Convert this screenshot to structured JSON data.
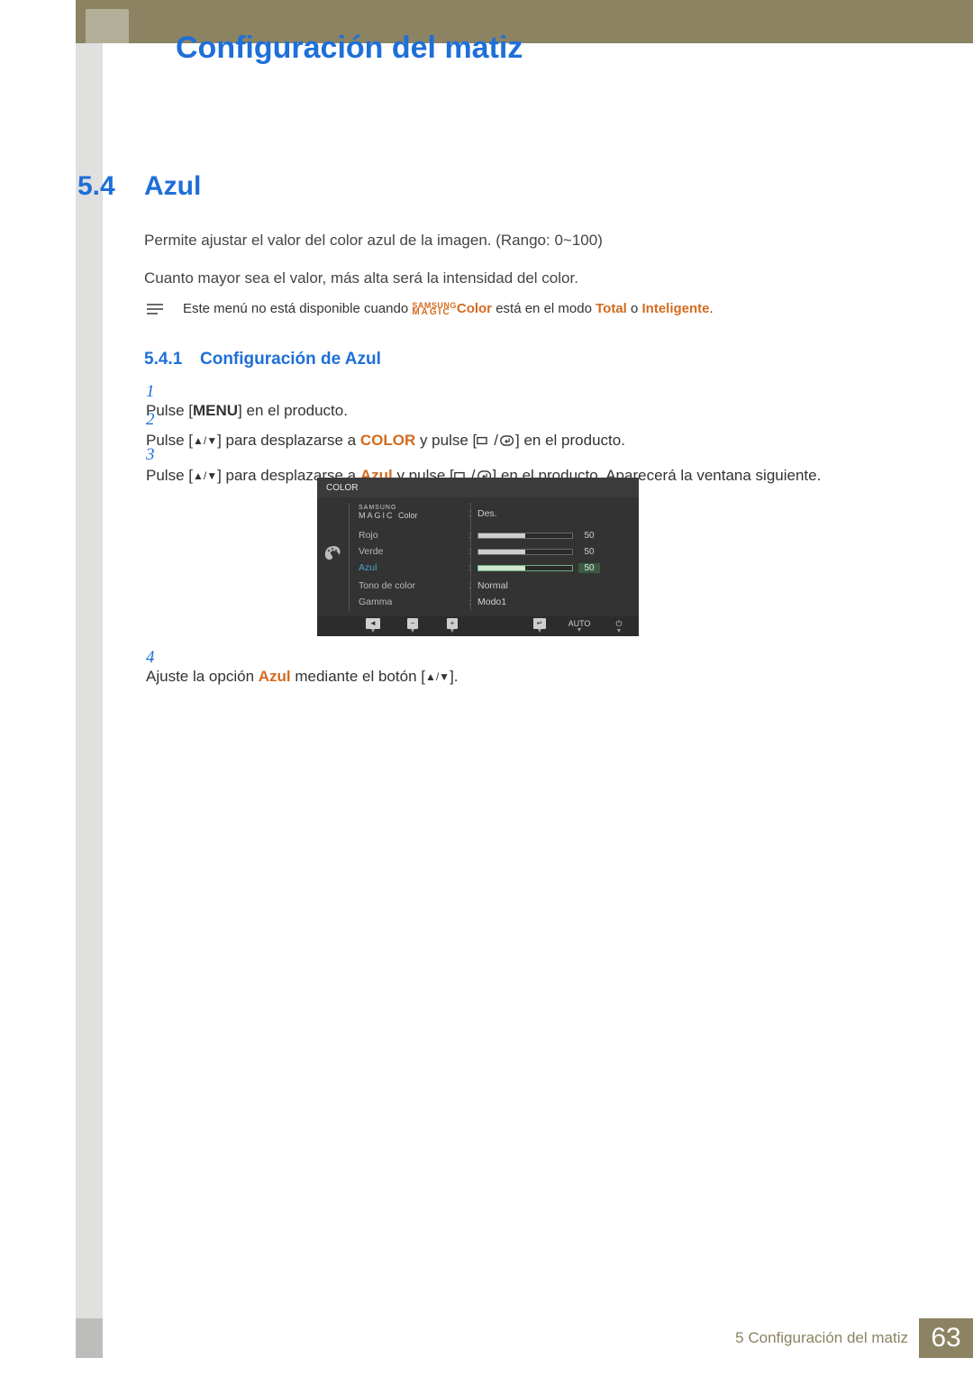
{
  "chapter_title": "Configuración del matiz",
  "section": {
    "num": "5.4",
    "title": "Azul"
  },
  "para1": "Permite ajustar el valor del color azul de la imagen. (Rango: 0~100)",
  "para2": "Cuanto mayor sea el valor, más alta será la intensidad del color.",
  "note": {
    "pre": "Este menú no está disponible cuando ",
    "magic_top": "SAMSUNG",
    "magic_bottom": "MAGIC",
    "magic_suffix": "Color",
    "mid": " está en el modo ",
    "opt1": "Total",
    "or": " o ",
    "opt2": "Inteligente",
    "end": "."
  },
  "subsection": {
    "num": "5.4.1",
    "title": "Configuración de Azul"
  },
  "steps": {
    "s1": {
      "n": "1",
      "pre": "Pulse [",
      "menu": "MENU",
      "post": "] en el producto."
    },
    "s2": {
      "n": "2",
      "pre": "Pulse [",
      "mid1": "] para desplazarse a ",
      "color": "COLOR",
      "mid2": " y pulse [",
      "post": "] en el producto."
    },
    "s3": {
      "n": "3",
      "pre": "Pulse [",
      "mid1": "] para desplazarse a ",
      "azul": "Azul",
      "mid2": " y pulse [",
      "post": "] en el producto. Aparecerá la ventana siguiente."
    },
    "s4": {
      "n": "4",
      "pre": "Ajuste la opción ",
      "azul": "Azul",
      "mid": " mediante el botón [",
      "post": "]."
    }
  },
  "osd": {
    "title": "COLOR",
    "magic_top": "SAMSUNG",
    "magic_bottom": "MAGIC",
    "magic_suffix": "Color",
    "rows": {
      "magic_val": "Des.",
      "rojo": {
        "label": "Rojo",
        "value": 50
      },
      "verde": {
        "label": "Verde",
        "value": 50
      },
      "azul": {
        "label": "Azul",
        "value": 50
      },
      "tono": {
        "label": "Tono de color",
        "value": "Normal"
      },
      "gamma": {
        "label": "Gamma",
        "value": "Modo1"
      }
    },
    "footer": {
      "auto": "AUTO"
    }
  },
  "footer": {
    "label": "5 Configuración del matiz",
    "page": "63"
  }
}
